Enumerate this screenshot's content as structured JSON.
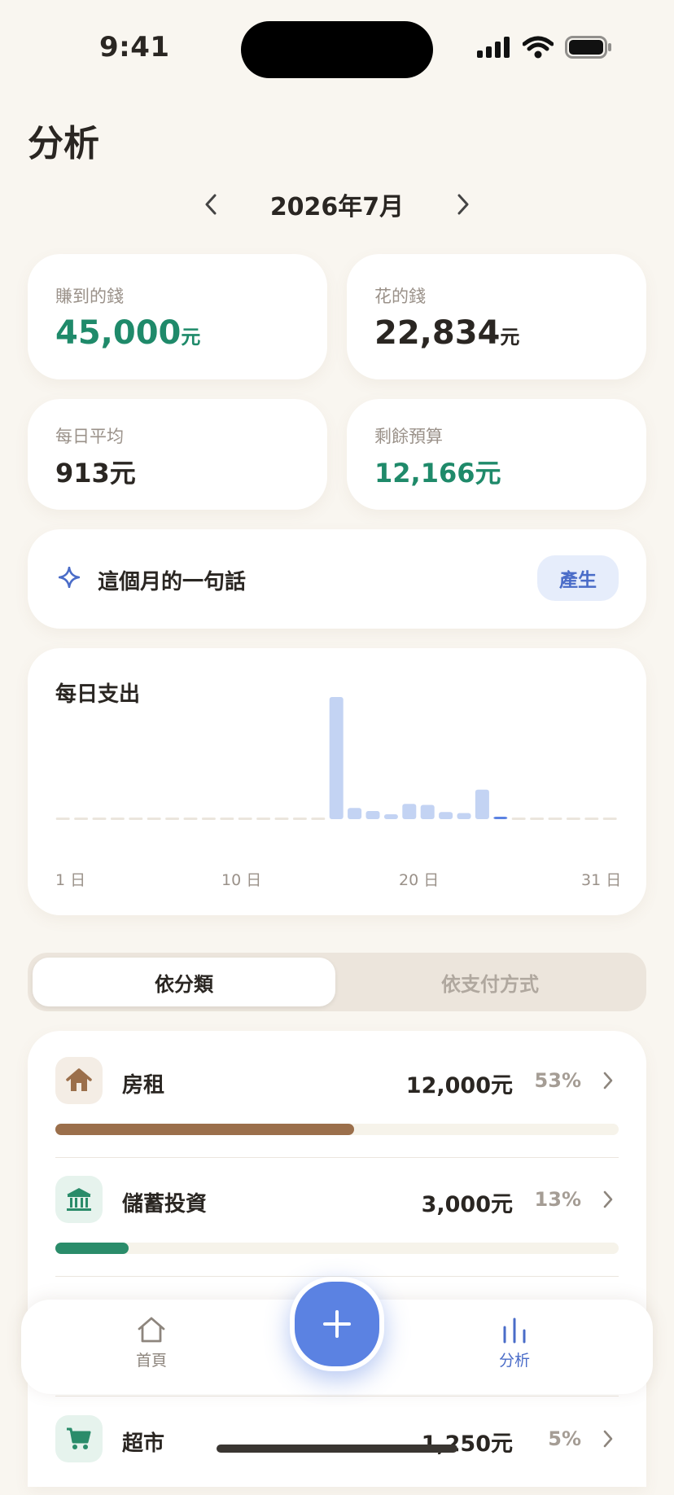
{
  "status": {
    "time": "9:41"
  },
  "header": {
    "title": "分析",
    "month": "2026年7月"
  },
  "stats": {
    "income": {
      "label": "賺到的錢",
      "value": "45,000",
      "unit": "元"
    },
    "expense": {
      "label": "花的錢",
      "value": "22,834",
      "unit": "元"
    },
    "daily_avg": {
      "label": "每日平均",
      "value": "913元"
    },
    "remaining": {
      "label": "剩餘預算",
      "value": "12,166元"
    }
  },
  "quote": {
    "title": "這個月的一句話",
    "button": "產生"
  },
  "chart_data": {
    "type": "bar",
    "title": "每日支出",
    "x_tick_labels": [
      "1 日",
      "10 日",
      "20 日",
      "31 日"
    ],
    "categories": [
      1,
      2,
      3,
      4,
      5,
      6,
      7,
      8,
      9,
      10,
      11,
      12,
      13,
      14,
      15,
      16,
      17,
      18,
      19,
      20,
      21,
      22,
      23,
      24,
      25,
      26,
      27,
      28,
      29,
      30,
      31
    ],
    "values": [
      0,
      0,
      0,
      0,
      0,
      0,
      0,
      0,
      0,
      0,
      0,
      0,
      0,
      0,
      0,
      12000,
      1100,
      800,
      400,
      1500,
      1400,
      700,
      600,
      2900,
      300,
      0,
      0,
      0,
      0,
      0,
      0
    ],
    "highlight_day": 25,
    "ylim": [
      0,
      12000
    ],
    "grid": false,
    "colors": {
      "bar": "#c3d3f3",
      "highlight": "#5b82e2",
      "empty": "#ebe6dd"
    }
  },
  "segmented": {
    "by_category": "依分類",
    "by_payment": "依支付方式"
  },
  "categories": [
    {
      "name": "房租",
      "amount": "12,000元",
      "pct": "53%",
      "share": 0.53,
      "color": "#9b6f4b",
      "icon_bg": "#f4ede5",
      "icon": "house-icon"
    },
    {
      "name": "儲蓄投資",
      "amount": "3,000元",
      "pct": "13%",
      "share": 0.13,
      "color": "#2a8c6a",
      "icon_bg": "#e6f3ed",
      "icon": "bank-icon"
    },
    {
      "name": "超市",
      "amount": "1,250元",
      "pct": "5%",
      "share": 0.05,
      "color": "#2a8c6a",
      "icon_bg": "#e6f3ed",
      "icon": "cart-icon"
    }
  ],
  "tabbar": {
    "home": "首頁",
    "analytics": "分析"
  },
  "colors": {
    "accent": "#5b82e2",
    "income": "#1f8a6a",
    "background": "#f9f6f0"
  }
}
